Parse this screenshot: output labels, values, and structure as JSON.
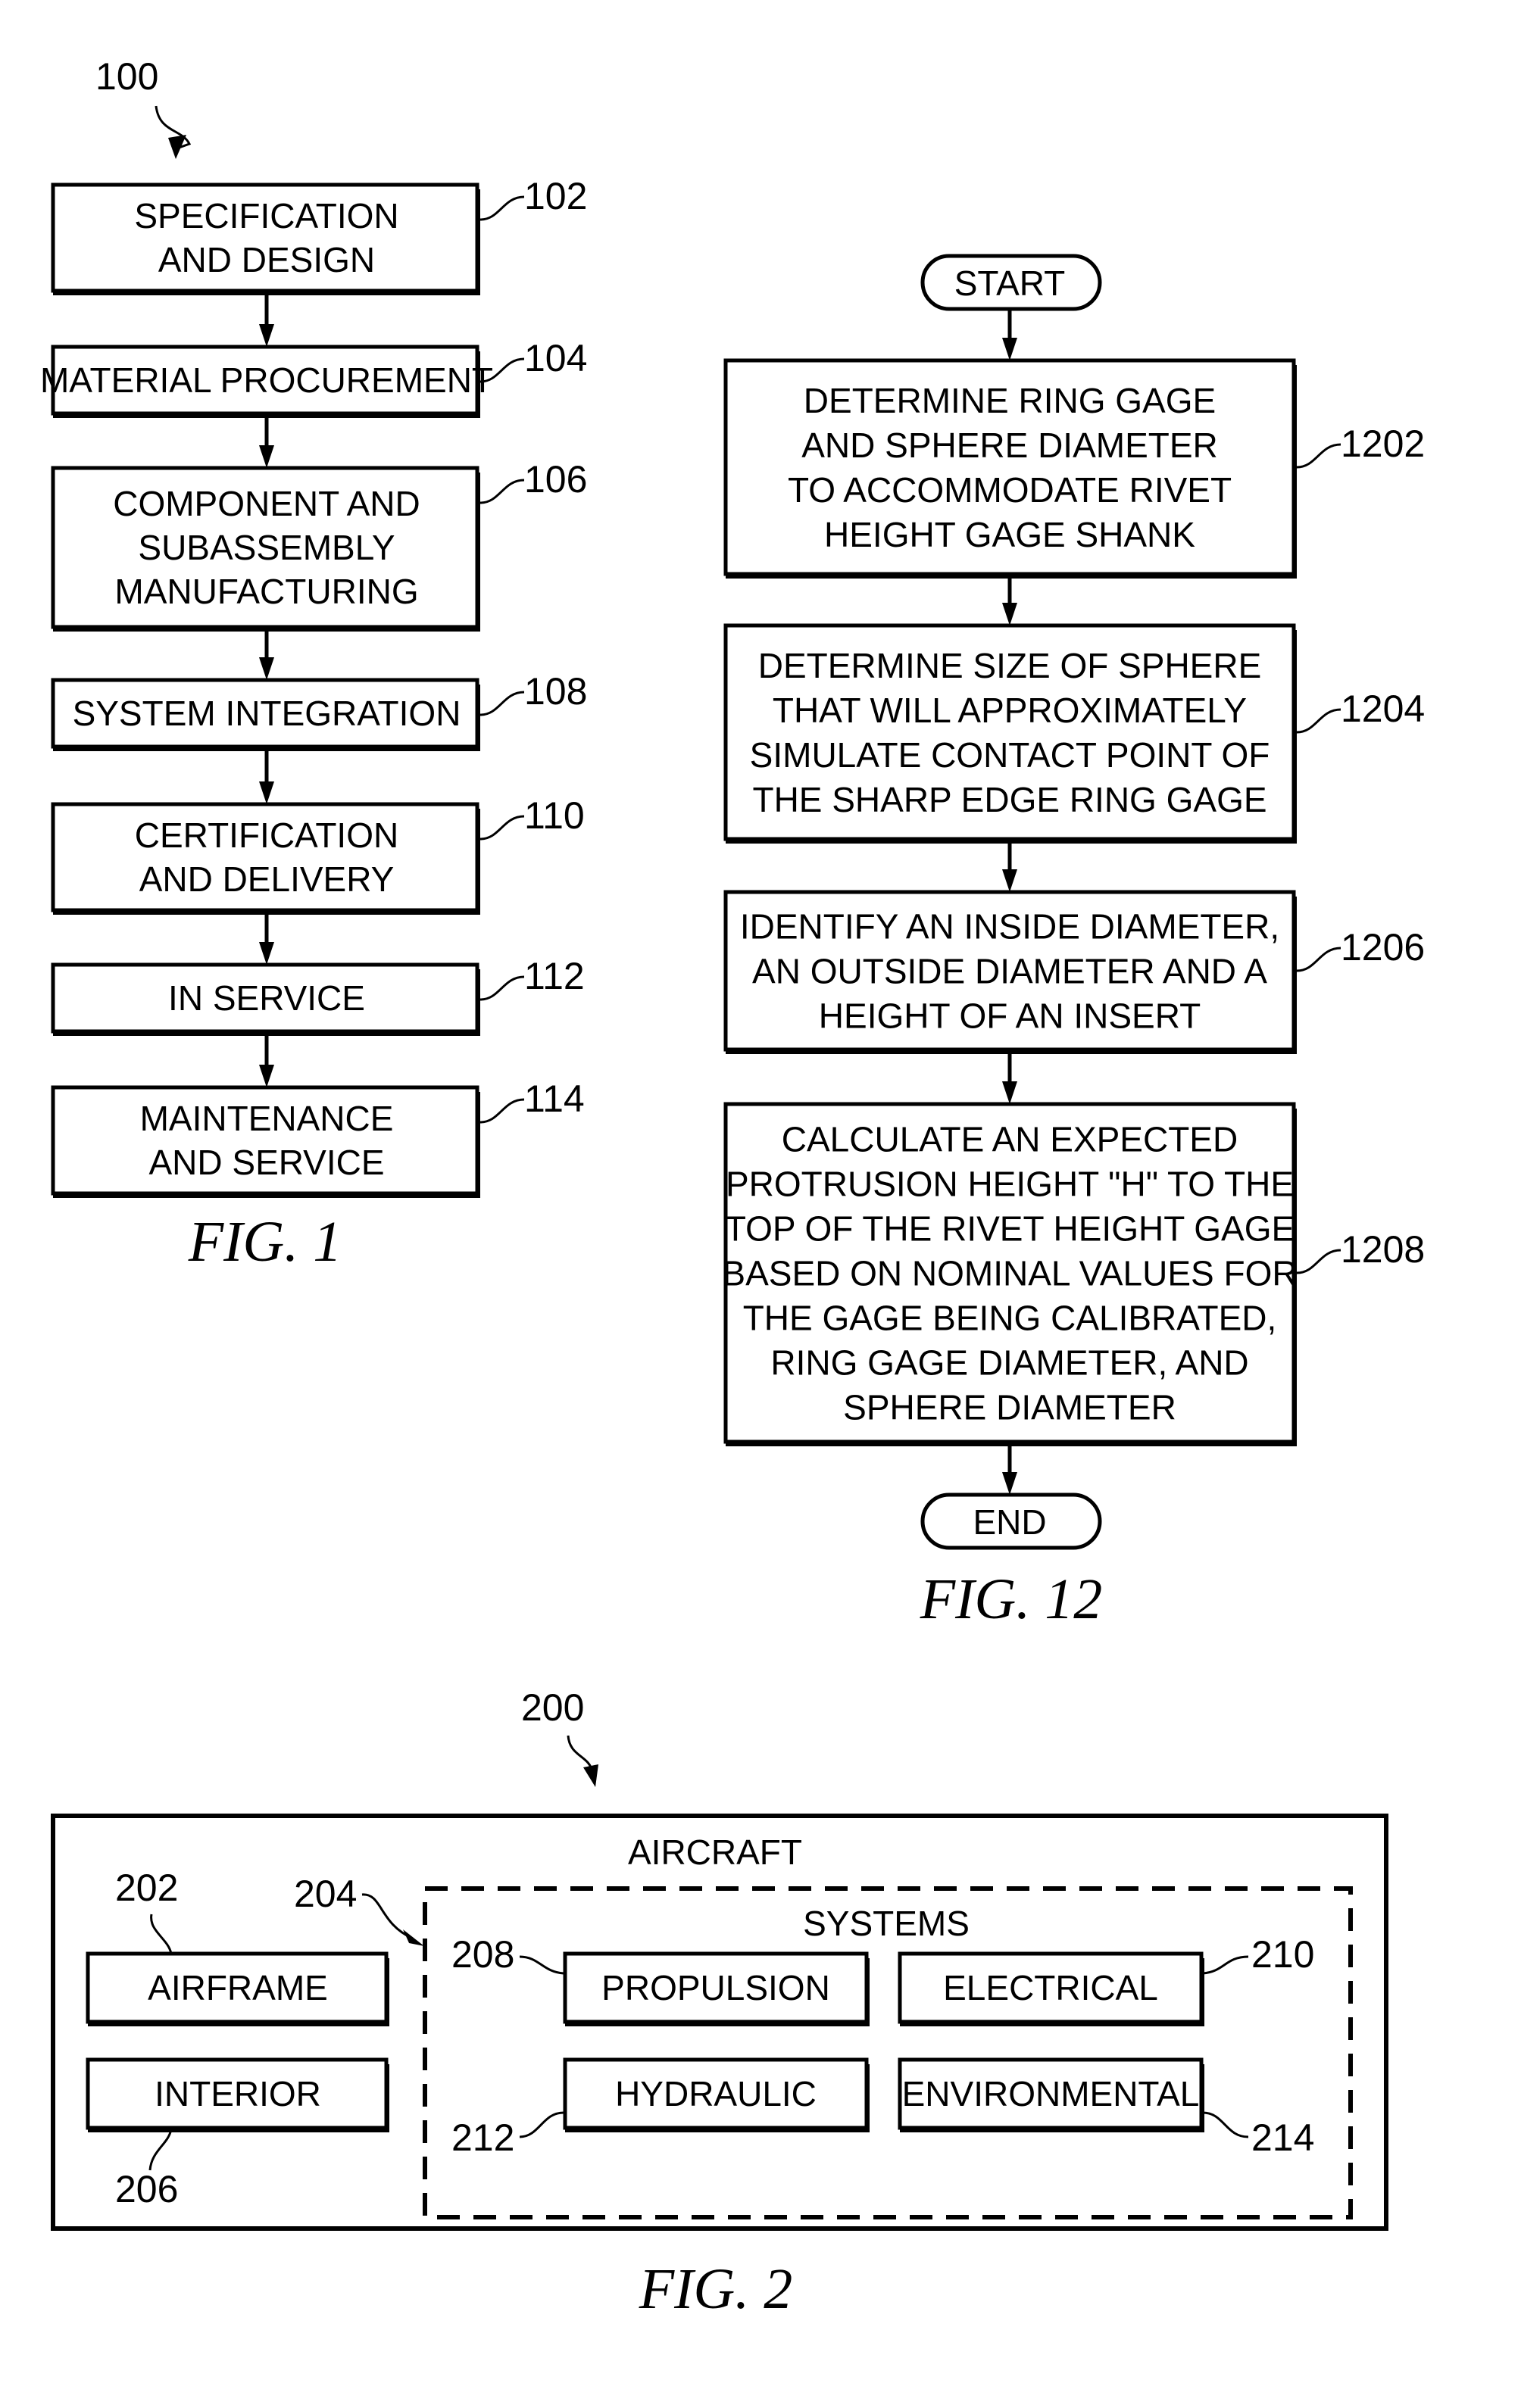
{
  "fig1": {
    "ref": "100",
    "caption": "FIG. 1",
    "steps": [
      {
        "ref": "102",
        "lines": [
          "SPECIFICATION",
          "AND DESIGN"
        ]
      },
      {
        "ref": "104",
        "lines": [
          "MATERIAL PROCUREMENT"
        ]
      },
      {
        "ref": "106",
        "lines": [
          "COMPONENT AND",
          "SUBASSEMBLY",
          "MANUFACTURING"
        ]
      },
      {
        "ref": "108",
        "lines": [
          "SYSTEM INTEGRATION"
        ]
      },
      {
        "ref": "110",
        "lines": [
          "CERTIFICATION",
          "AND DELIVERY"
        ]
      },
      {
        "ref": "112",
        "lines": [
          "IN SERVICE"
        ]
      },
      {
        "ref": "114",
        "lines": [
          "MAINTENANCE",
          "AND SERVICE"
        ]
      }
    ]
  },
  "fig12": {
    "caption": "FIG. 12",
    "start": "START",
    "end": "END",
    "steps": [
      {
        "ref": "1202",
        "lines": [
          "DETERMINE RING GAGE",
          "AND SPHERE DIAMETER",
          "TO ACCOMMODATE RIVET",
          "HEIGHT GAGE SHANK"
        ]
      },
      {
        "ref": "1204",
        "lines": [
          "DETERMINE SIZE OF SPHERE",
          "THAT WILL APPROXIMATELY",
          "SIMULATE CONTACT POINT OF",
          "THE SHARP EDGE RING GAGE"
        ]
      },
      {
        "ref": "1206",
        "lines": [
          "IDENTIFY AN INSIDE DIAMETER,",
          "AN OUTSIDE DIAMETER AND A",
          "HEIGHT OF AN INSERT"
        ]
      },
      {
        "ref": "1208",
        "lines": [
          "CALCULATE AN EXPECTED",
          "PROTRUSION HEIGHT \"H\" TO THE",
          "TOP OF THE RIVET HEIGHT GAGE",
          "BASED ON NOMINAL VALUES FOR",
          "THE GAGE BEING CALIBRATED,",
          "RING GAGE DIAMETER, AND",
          "SPHERE DIAMETER"
        ]
      }
    ]
  },
  "fig2": {
    "ref": "200",
    "caption": "FIG. 2",
    "aircraft_label": "AIRCRAFT",
    "systems_label": "SYSTEMS",
    "systems_ref": "204",
    "airframe": {
      "ref": "202",
      "label": "AIRFRAME"
    },
    "interior": {
      "ref": "206",
      "label": "INTERIOR"
    },
    "propulsion": {
      "ref": "208",
      "label": "PROPULSION"
    },
    "electrical": {
      "ref": "210",
      "label": "ELECTRICAL"
    },
    "hydraulic": {
      "ref": "212",
      "label": "HYDRAULIC"
    },
    "environmental": {
      "ref": "214",
      "label": "ENVIRONMENTAL"
    }
  }
}
